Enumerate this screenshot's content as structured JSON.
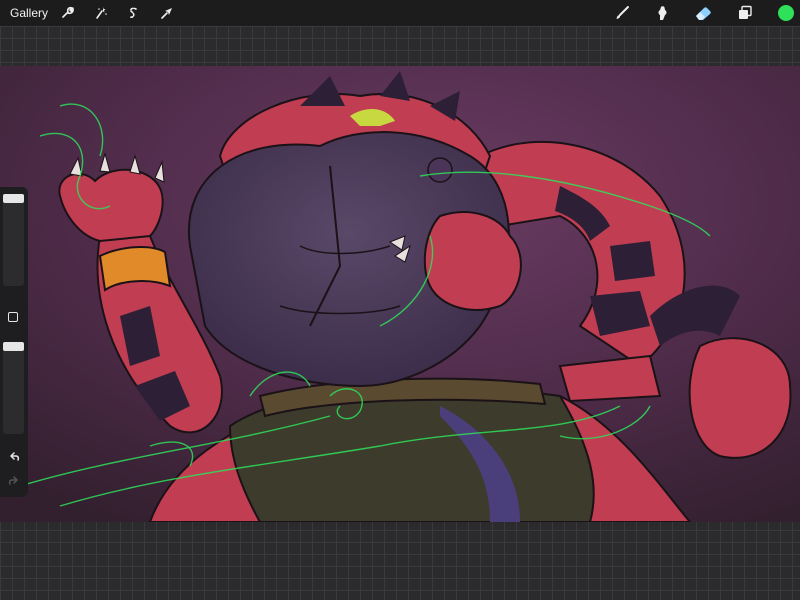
{
  "app": {
    "gallery_label": "Gallery",
    "accent_color": "#2ee05a"
  },
  "toolbar_left": {
    "items": [
      {
        "icon": "wrench-icon",
        "name": "actions"
      },
      {
        "icon": "magic-wand-icon",
        "name": "adjustments"
      },
      {
        "icon": "selection-icon",
        "name": "selection"
      },
      {
        "icon": "arrow-cursor-icon",
        "name": "transform"
      }
    ]
  },
  "toolbar_right": {
    "items": [
      {
        "icon": "brush-icon",
        "name": "paint"
      },
      {
        "icon": "smudge-icon",
        "name": "smudge"
      },
      {
        "icon": "eraser-icon",
        "name": "erase"
      },
      {
        "icon": "layers-icon",
        "name": "layers"
      },
      {
        "icon": "color-swatch-icon",
        "name": "color"
      }
    ]
  },
  "sidebar": {
    "brush_size_level": 1.0,
    "opacity_level": 1.0,
    "undo_icon": "undo-icon",
    "redo_icon": "redo-icon"
  },
  "canvas": {
    "subject": "digital-illustration"
  }
}
